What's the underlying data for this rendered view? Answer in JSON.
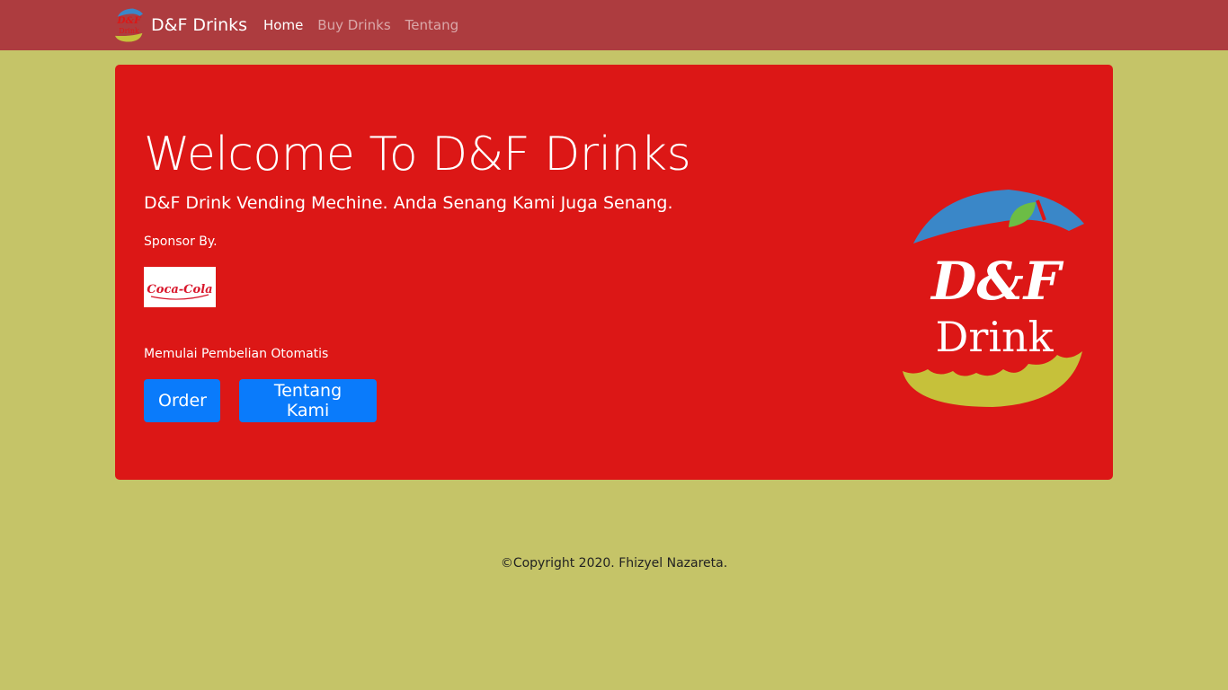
{
  "navbar": {
    "brand": "D&F Drinks",
    "links": [
      {
        "label": "Home",
        "active": true
      },
      {
        "label": "Buy Drinks",
        "active": false
      },
      {
        "label": "Tentang",
        "active": false
      }
    ]
  },
  "hero": {
    "title": "Welcome To D&F Drinks",
    "lead": "D&F Drink Vending Mechine. Anda Senang Kami Juga Senang.",
    "sponsor_label": "Sponsor By.",
    "sponsor_logo_text": "Coca-Cola",
    "auto_label": "Memulai Pembelian Otomatis",
    "order_button": "Order",
    "about_button": "Tentang Kami",
    "logo_line1": "D&F",
    "logo_line2": "Drink"
  },
  "footer": {
    "copyright": "©Copyright 2020. Fhizyel Nazareta."
  },
  "colors": {
    "page_bg": "#c5c468",
    "navbar_bg": "#ad3c3f",
    "hero_bg": "#dc1716",
    "button_bg": "#0a7bfb",
    "logo_blue": "#3a87c8",
    "logo_green": "#6cbd45",
    "logo_yellow": "#c6c13a"
  }
}
